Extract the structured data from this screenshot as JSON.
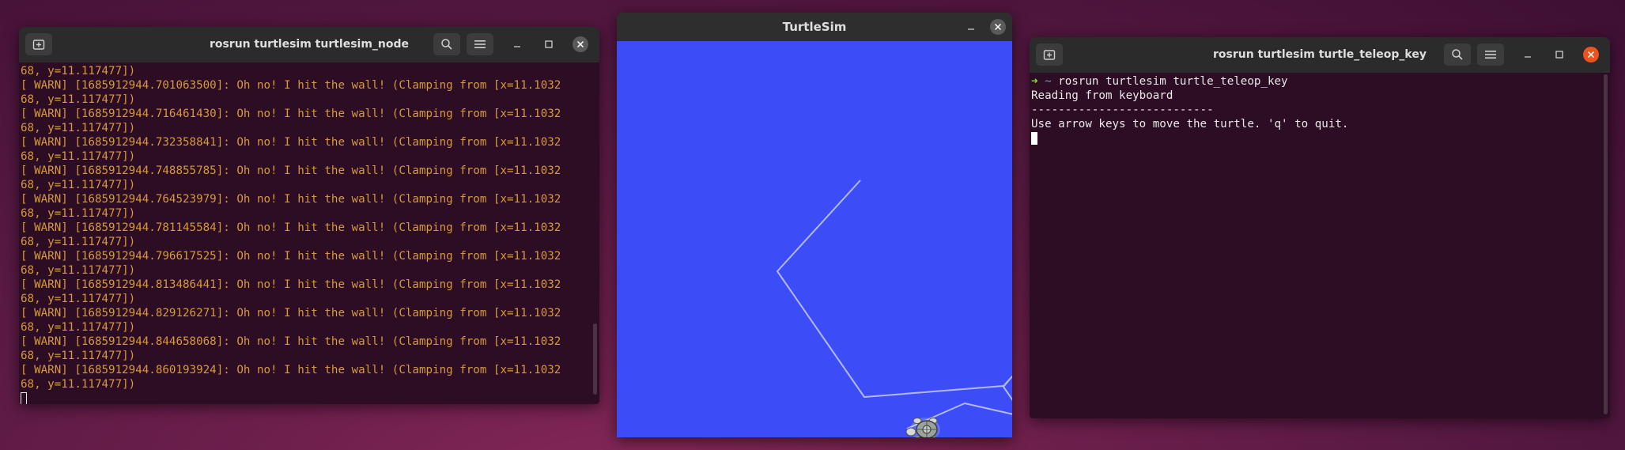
{
  "terminal_left": {
    "title": "rosrun turtlesim turtlesim_node",
    "lines": [
      {
        "text": "68, y=11.117477])"
      },
      {
        "text": "[ WARN] [1685912944.701063500]: Oh no! I hit the wall! (Clamping from [x=11.1032"
      },
      {
        "text": "68, y=11.117477])"
      },
      {
        "text": "[ WARN] [1685912944.716461430]: Oh no! I hit the wall! (Clamping from [x=11.1032"
      },
      {
        "text": "68, y=11.117477])"
      },
      {
        "text": "[ WARN] [1685912944.732358841]: Oh no! I hit the wall! (Clamping from [x=11.1032"
      },
      {
        "text": "68, y=11.117477])"
      },
      {
        "text": "[ WARN] [1685912944.748855785]: Oh no! I hit the wall! (Clamping from [x=11.1032"
      },
      {
        "text": "68, y=11.117477])"
      },
      {
        "text": "[ WARN] [1685912944.764523979]: Oh no! I hit the wall! (Clamping from [x=11.1032"
      },
      {
        "text": "68, y=11.117477])"
      },
      {
        "text": "[ WARN] [1685912944.781145584]: Oh no! I hit the wall! (Clamping from [x=11.1032"
      },
      {
        "text": "68, y=11.117477])"
      },
      {
        "text": "[ WARN] [1685912944.796617525]: Oh no! I hit the wall! (Clamping from [x=11.1032"
      },
      {
        "text": "68, y=11.117477])"
      },
      {
        "text": "[ WARN] [1685912944.813486441]: Oh no! I hit the wall! (Clamping from [x=11.1032"
      },
      {
        "text": "68, y=11.117477])"
      },
      {
        "text": "[ WARN] [1685912944.829126271]: Oh no! I hit the wall! (Clamping from [x=11.1032"
      },
      {
        "text": "68, y=11.117477])"
      },
      {
        "text": "[ WARN] [1685912944.844658068]: Oh no! I hit the wall! (Clamping from [x=11.1032"
      },
      {
        "text": "68, y=11.117477])"
      },
      {
        "text": "[ WARN] [1685912944.860193924]: Oh no! I hit the wall! (Clamping from [x=11.1032"
      },
      {
        "text": "68, y=11.117477])"
      }
    ]
  },
  "turtlesim": {
    "title": "TurtleSim",
    "background_color": "#3c4df7",
    "pen_color": "#b3b8ff"
  },
  "terminal_right": {
    "title": "rosrun turtlesim turtle_teleop_key",
    "prompt_arrow": "➜",
    "prompt_dir": "~",
    "command": "rosrun turtlesim turtle_teleop_key",
    "output": [
      "Reading from keyboard",
      "---------------------------",
      "Use arrow keys to move the turtle. 'q' to quit."
    ]
  },
  "colors": {
    "terminal_bg": "#2c0d23",
    "warn_text": "#d79a3c",
    "close_active": "#e95420"
  },
  "icons": {
    "new_tab": "new-tab-icon",
    "search": "search-icon",
    "menu": "hamburger-menu-icon",
    "minimize": "minimize-icon",
    "maximize": "maximize-icon",
    "close": "close-icon"
  }
}
